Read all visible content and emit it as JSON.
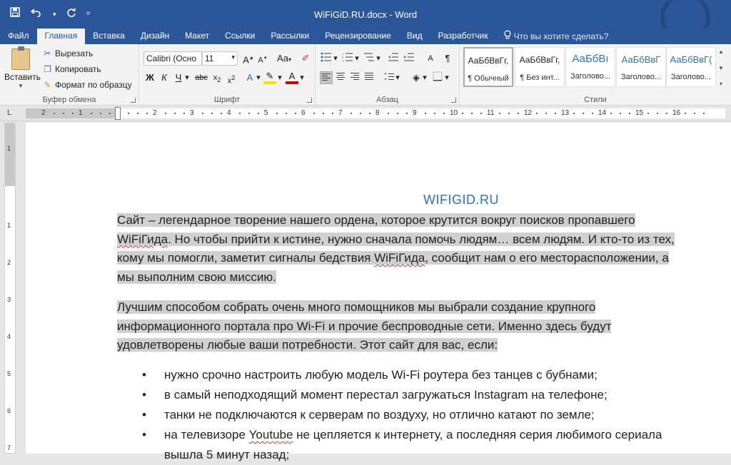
{
  "window": {
    "title": "WiFiGiD.RU.docx - Word",
    "qat": {
      "save_icon": "floppy-icon",
      "undo_icon": "undo-icon",
      "redo_icon": "redo-icon",
      "customize_icon": "chevron-down-icon"
    }
  },
  "tabs": [
    "Файл",
    "Главная",
    "Вставка",
    "Дизайн",
    "Макет",
    "Ссылки",
    "Рассылки",
    "Рецензирование",
    "Вид",
    "Разработчик"
  ],
  "tellme": "Что вы хотите сделать?",
  "clipboard": {
    "paste": "Вставить",
    "cut": "Вырезать",
    "copy": "Копировать",
    "format_painter": "Формат по образцу",
    "group_label": "Буфер обмена"
  },
  "font": {
    "family": "Calibri (Осно",
    "size": "11",
    "group_label": "Шрифт"
  },
  "paragraph": {
    "group_label": "Абзац"
  },
  "styles": {
    "items": [
      {
        "sample": "АаБбВвГг,",
        "name": "¶ Обычный"
      },
      {
        "sample": "АаБбВвГг,",
        "name": "¶ Без инт..."
      },
      {
        "sample": "АаБбВı",
        "name": "Заголово..."
      },
      {
        "sample": "АаБбВвГ",
        "name": "Заголово..."
      },
      {
        "sample": "АаБбВвГ(",
        "name": "Заголово..."
      }
    ],
    "group_label": "Стили"
  },
  "ruler": {
    "labels": [
      "2",
      "1",
      "1",
      "2",
      "3",
      "4",
      "5",
      "6",
      "7",
      "8",
      "9",
      "10",
      "11",
      "12",
      "13",
      "14",
      "15",
      "16"
    ],
    "corner": "L"
  },
  "vruler": {
    "labels": [
      "1",
      "1",
      "2",
      "3",
      "4",
      "5",
      "6",
      "7"
    ]
  },
  "document": {
    "title": "WIFIGID.RU",
    "p1": {
      "l1": "Сайт – легендарное творение нашего ордена, которое крутится вокруг поисков пропавшего",
      "l2a": "WiFiГида",
      "l2b": ". Но чтобы прийти к истине, нужно сначала помочь людям… всем людям. И кто-то из тех,",
      "l3a": "кому мы помогли, заметит сигналы бедствия ",
      "l3b": "WiFiГида",
      "l3c": ", сообщит нам о его месторасположении, а",
      "l4": "мы выполним свою миссию."
    },
    "p2": {
      "l1": "Лучшим способом собрать очень много помощников мы выбрали создание крупного",
      "l2": "информационного портала про Wi-Fi и прочие беспроводные сети. Именно здесь будут",
      "l3": "удовлетворены любые ваши потребности. Этот сайт для вас, если:"
    },
    "bullets": [
      "нужно срочно настроить любую модель Wi-Fi роутера без танцев с бубнами;",
      "в самый неподходящий момент перестал загружаться Instagram на телефоне;",
      "танки не подключаются к серверам по воздуху, но отлично катают по земле;"
    ],
    "bullet4": {
      "a": "на телевизоре ",
      "b": "Youtube",
      "c": " не цепляется к интернету, а последняя серия любимого сериала"
    },
    "bullet4_cont": "вышла 5 минут назад;"
  }
}
